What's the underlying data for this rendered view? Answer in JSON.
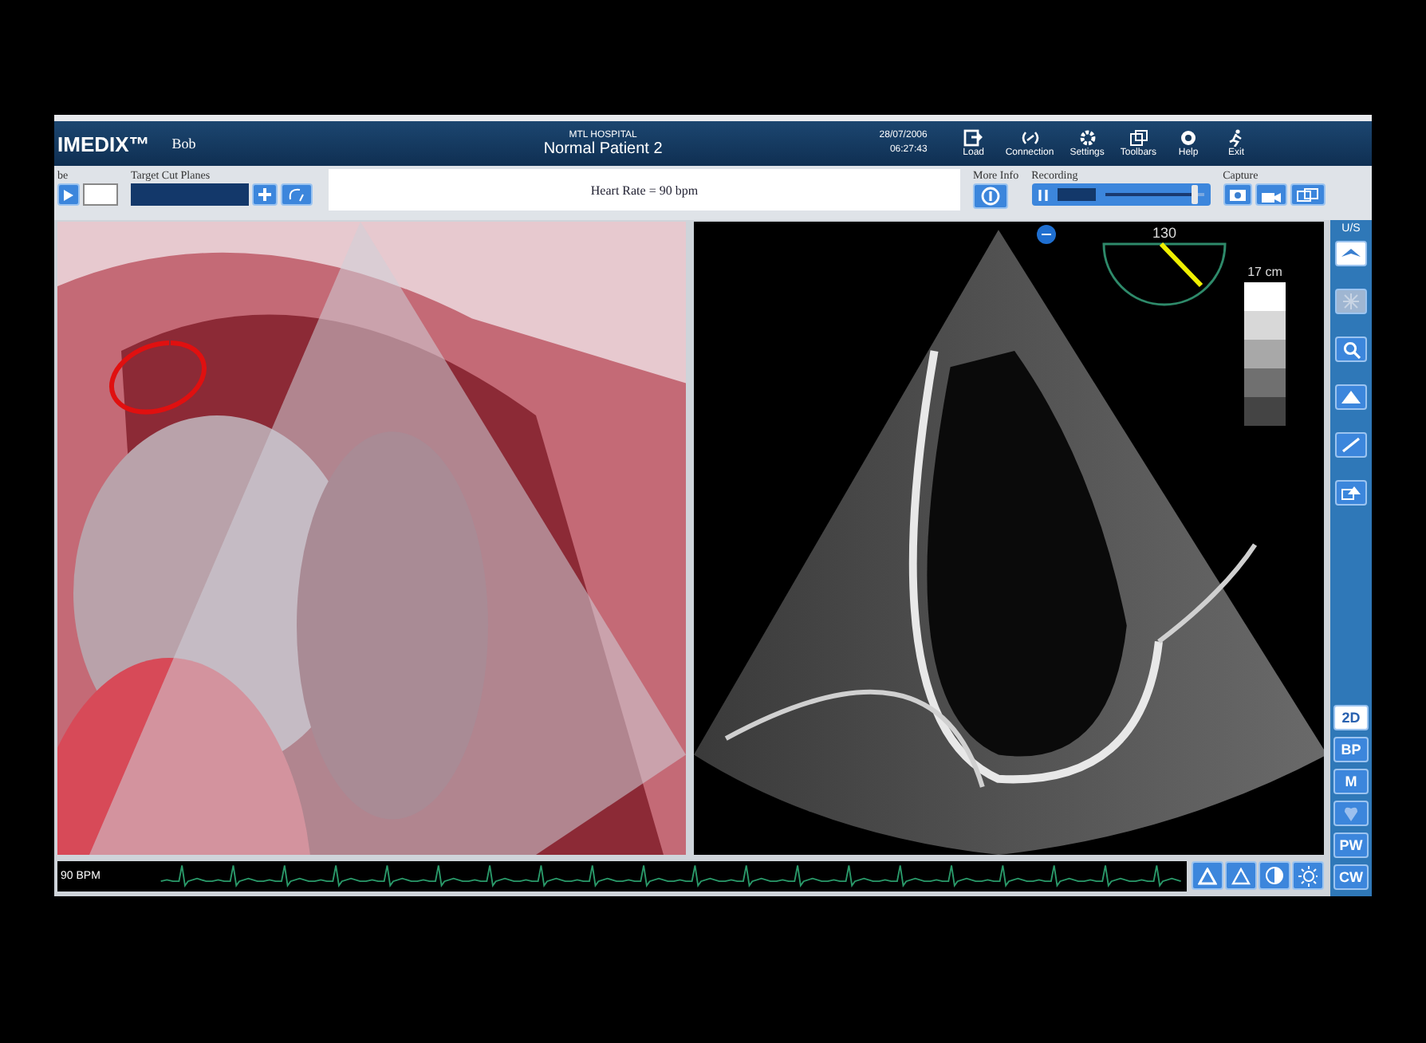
{
  "header": {
    "logo": "IMEDIX™",
    "user": "Bob",
    "hospital": "MTL HOSPITAL",
    "patient": "Normal Patient 2",
    "date": "28/07/2006",
    "time": "06:27:43",
    "menu": [
      {
        "label": "Load",
        "kind": "load"
      },
      {
        "label": "Connection",
        "kind": "connection"
      },
      {
        "label": "Settings",
        "kind": "settings"
      },
      {
        "label": "Toolbars",
        "kind": "toolbars"
      },
      {
        "label": "Help",
        "kind": "help"
      },
      {
        "label": "Exit",
        "kind": "exit"
      }
    ]
  },
  "toolbar": {
    "probe_label": "be",
    "cut_planes_label": "Target Cut Planes",
    "message": "Heart Rate = 90 bpm",
    "more_info_label": "More Info",
    "recording_label": "Recording",
    "recording": {
      "level": 0.95
    },
    "capture_label": "Capture"
  },
  "ultrasound": {
    "angle": "130",
    "depth": "17 cm"
  },
  "sidebar": {
    "title": "U/S",
    "modes": [
      {
        "kind": "text",
        "label": "2D",
        "selected": true
      },
      {
        "kind": "text",
        "label": "BP",
        "selected": false
      },
      {
        "kind": "text",
        "label": "M",
        "selected": false
      },
      {
        "kind": "icon",
        "selected": false
      },
      {
        "kind": "text",
        "label": "PW",
        "selected": false
      },
      {
        "kind": "text",
        "label": "CW",
        "selected": false
      }
    ]
  },
  "ecg": {
    "label": "90 BPM"
  }
}
